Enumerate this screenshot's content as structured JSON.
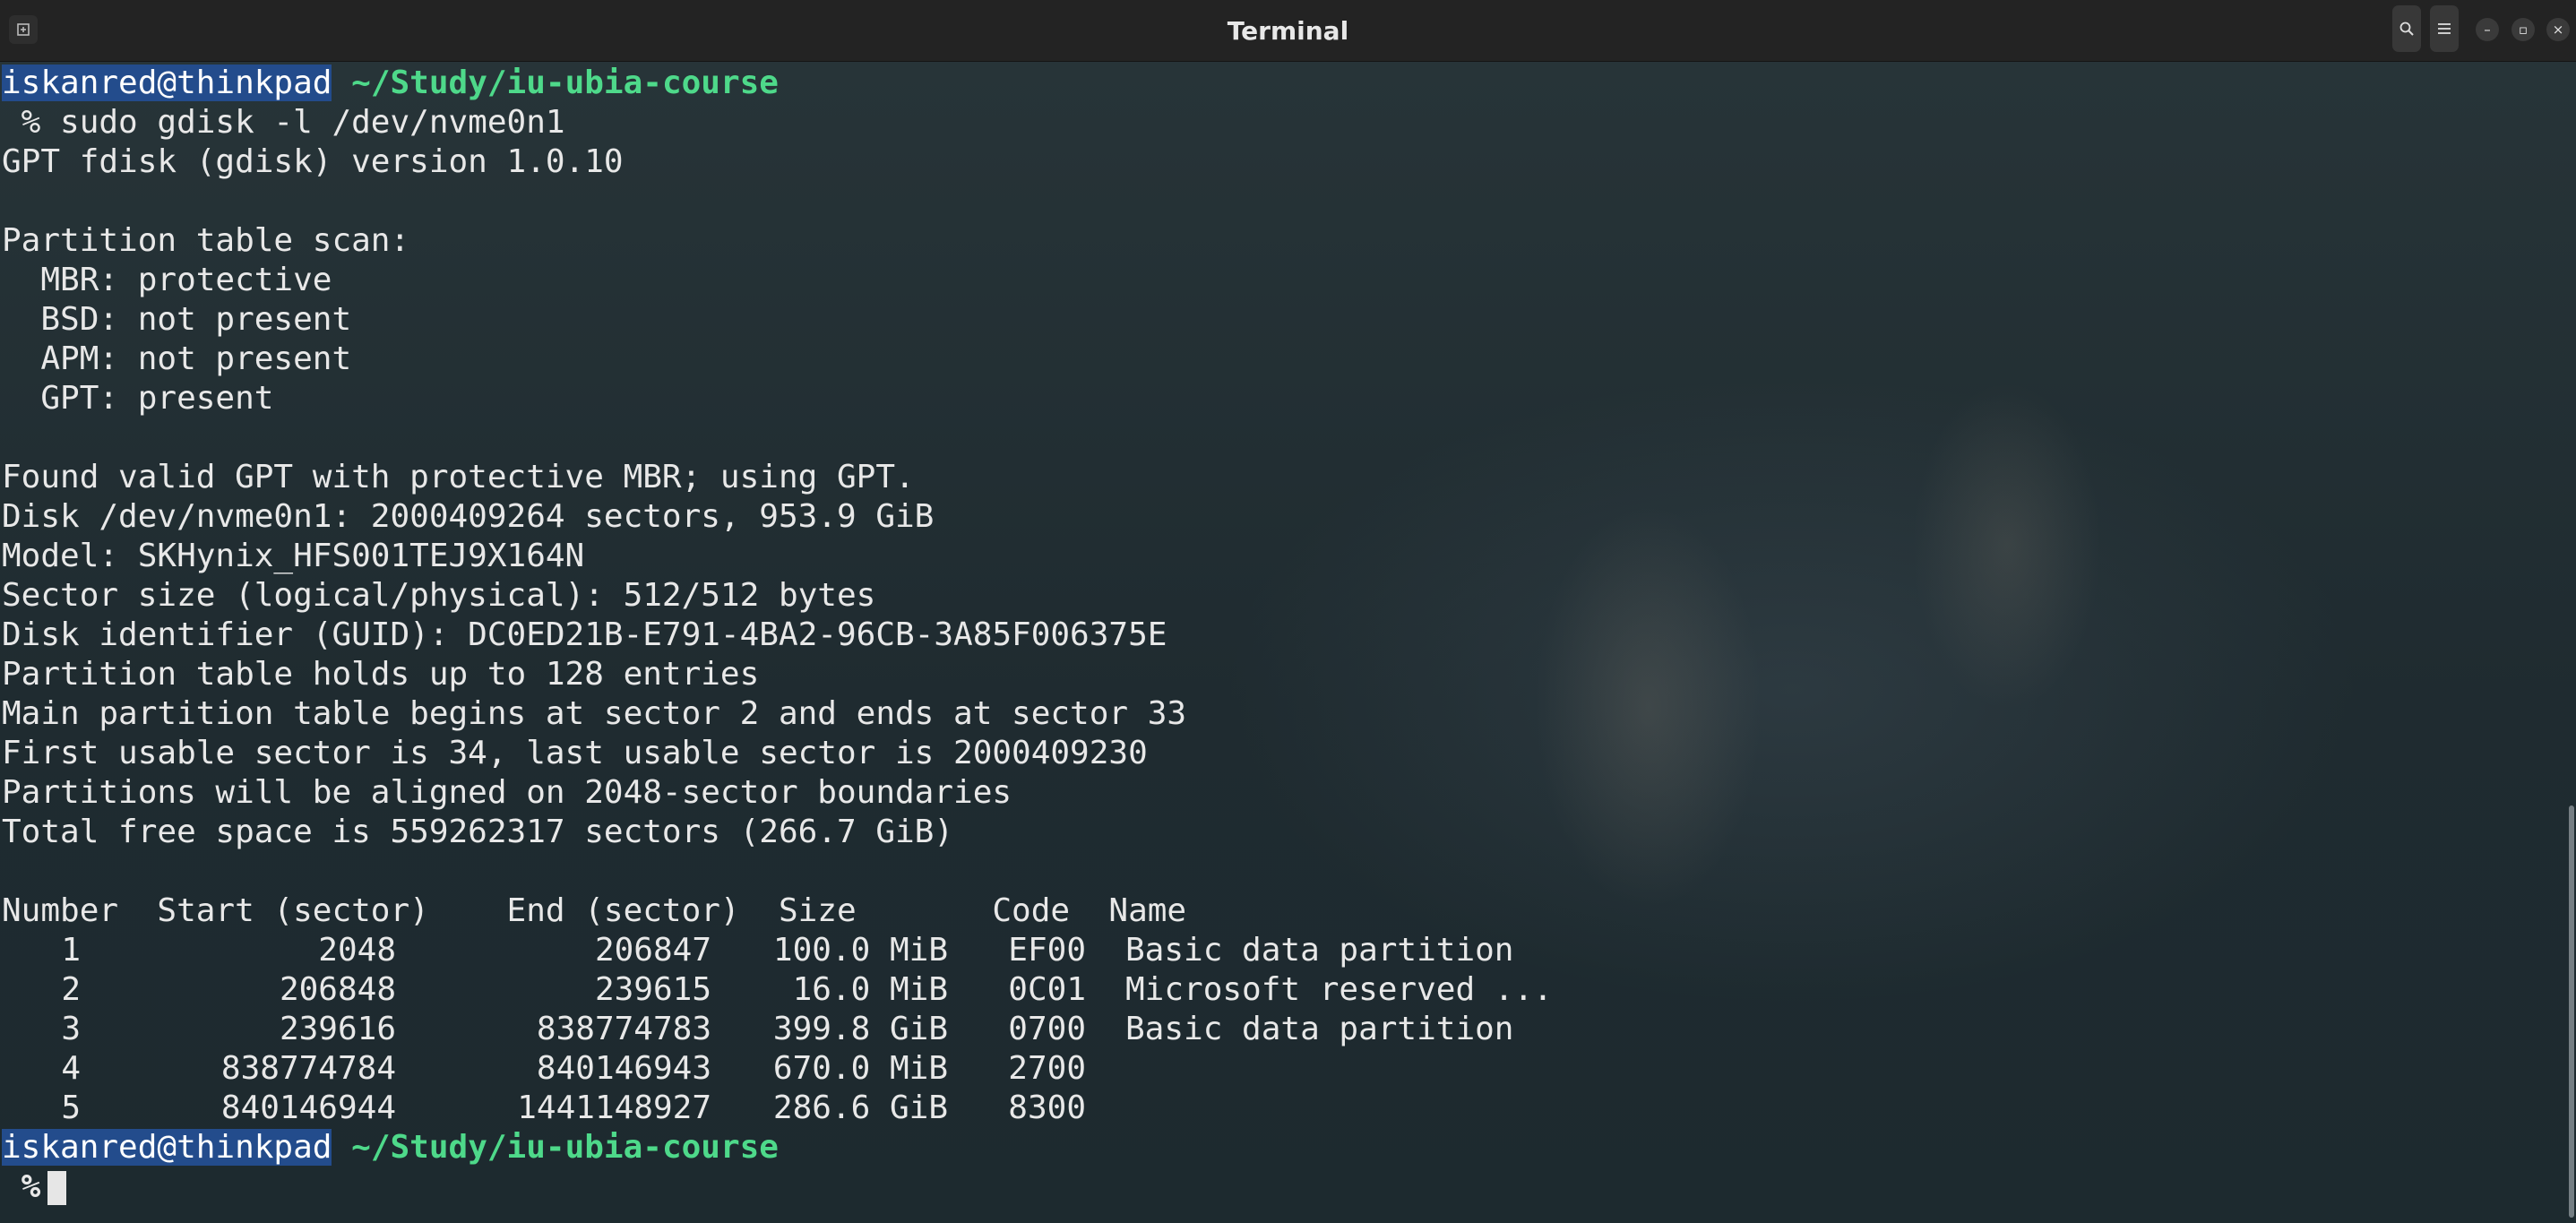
{
  "window": {
    "title": "Terminal",
    "buttons": {
      "new_tab_icon": "new-tab-icon",
      "search_icon": "search-icon",
      "menu_icon": "hamburger-menu-icon",
      "minimize_glyph": "–",
      "maximize_glyph": "▫",
      "close_glyph": "×"
    }
  },
  "prompt": {
    "user_host": "iskanred@thinkpad",
    "cwd": "~/Study/iu-ubia-course",
    "symbol": "%"
  },
  "command": " % sudo gdisk -l /dev/nvme0n1",
  "output": [
    "GPT fdisk (gdisk) version 1.0.10",
    "",
    "Partition table scan:",
    "  MBR: protective",
    "  BSD: not present",
    "  APM: not present",
    "  GPT: present",
    "",
    "Found valid GPT with protective MBR; using GPT.",
    "Disk /dev/nvme0n1: 2000409264 sectors, 953.9 GiB",
    "Model: SKHynix_HFS001TEJ9X164N",
    "Sector size (logical/physical): 512/512 bytes",
    "Disk identifier (GUID): DC0ED21B-E791-4BA2-96CB-3A85F006375E",
    "Partition table holds up to 128 entries",
    "Main partition table begins at sector 2 and ends at sector 33",
    "First usable sector is 34, last usable sector is 2000409230",
    "Partitions will be aligned on 2048-sector boundaries",
    "Total free space is 559262317 sectors (266.7 GiB)",
    ""
  ],
  "table": {
    "header": "Number  Start (sector)    End (sector)  Size       Code  Name",
    "rows": [
      {
        "number": "1",
        "start": "2048",
        "end": "206847",
        "size": "100.0 MiB",
        "code": "EF00",
        "name": "Basic data partition"
      },
      {
        "number": "2",
        "start": "206848",
        "end": "239615",
        "size": "16.0 MiB",
        "code": "0C01",
        "name": "Microsoft reserved ..."
      },
      {
        "number": "3",
        "start": "239616",
        "end": "838774783",
        "size": "399.8 GiB",
        "code": "0700",
        "name": "Basic data partition"
      },
      {
        "number": "4",
        "start": "838774784",
        "end": "840146943",
        "size": "670.0 MiB",
        "code": "2700",
        "name": ""
      },
      {
        "number": "5",
        "start": "840146944",
        "end": "1441148927",
        "size": "286.6 GiB",
        "code": "8300",
        "name": ""
      }
    ]
  },
  "second_prompt": {
    "user_host": "iskanred@thinkpad",
    "cwd": "~/Study/iu-ubia-course",
    "symbol": " %"
  },
  "colors": {
    "prompt_user_bg": "#234c8c",
    "prompt_cwd": "#4ed98a",
    "text": "#e8e8e8",
    "titlebar": "#232323"
  }
}
